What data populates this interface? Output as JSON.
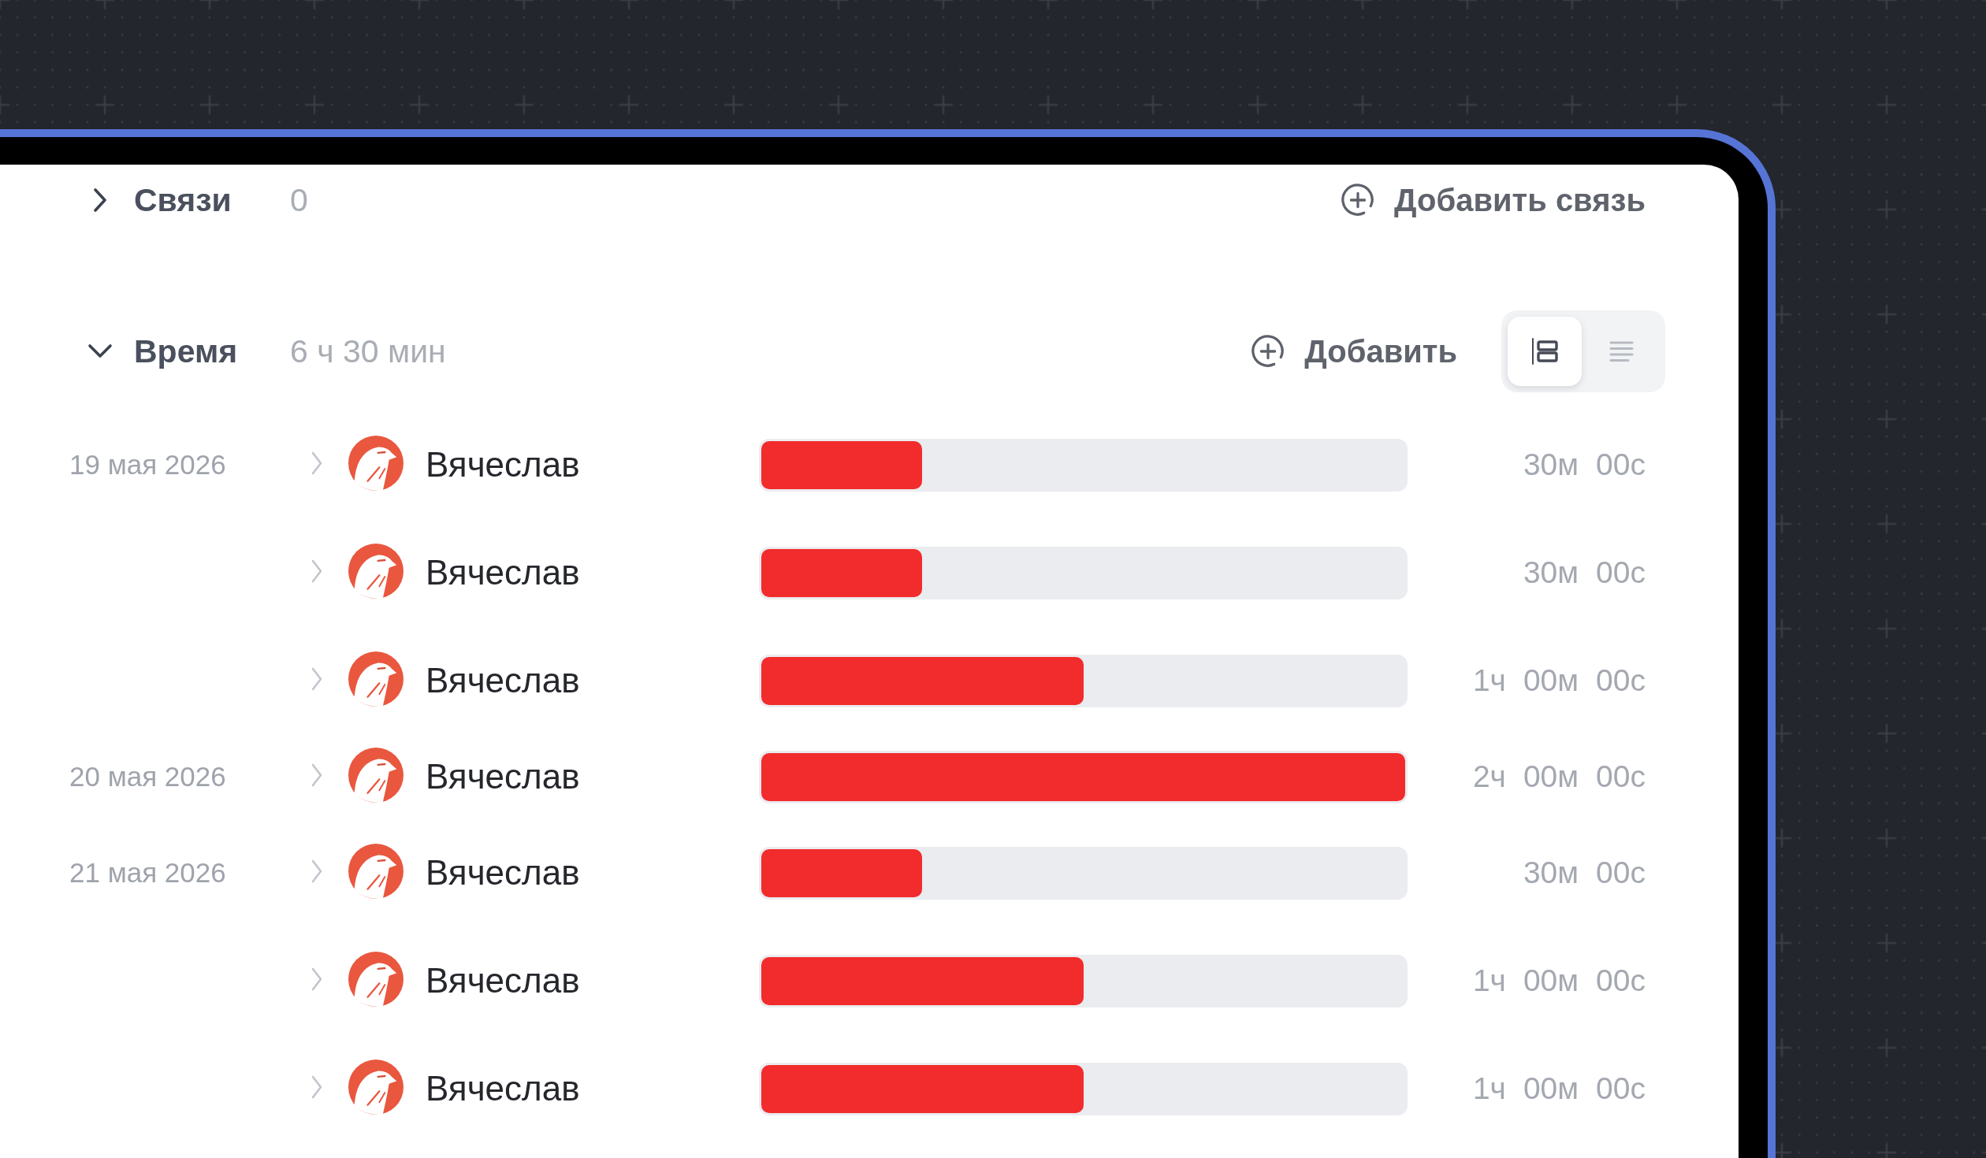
{
  "sections": [
    {
      "kind": "links",
      "title": "Связи",
      "count": "0",
      "expanded": false,
      "add_button": "Добавить связь"
    },
    {
      "kind": "time",
      "title": "Время",
      "count": "6 ч 30 мин",
      "expanded": true,
      "add_button": "Добавить",
      "view_toggle": [
        {
          "kind": "timeline",
          "selected": true
        },
        {
          "kind": "list",
          "selected": false
        }
      ],
      "groups": [
        {
          "date": "19 мая 2026",
          "entries": [
            {
              "name": "Вячеслав",
              "expanded": false,
              "level": 0.25,
              "duration": [
                "30м",
                "00с"
              ]
            },
            {
              "name": "Вячеслав",
              "expanded": false,
              "level": 0.25,
              "duration": [
                "30м",
                "00с"
              ]
            },
            {
              "name": "Вячеслав",
              "expanded": false,
              "level": 0.5,
              "duration": [
                "1ч",
                "00м",
                "00с"
              ]
            }
          ]
        },
        {
          "date": "20 мая 2026",
          "entries": [
            {
              "name": "Вячеслав",
              "expanded": false,
              "level": 1.0,
              "duration": [
                "2ч",
                "00м",
                "00с"
              ]
            }
          ]
        },
        {
          "date": "21 мая 2026",
          "entries": [
            {
              "name": "Вячеслав",
              "expanded": false,
              "level": 0.25,
              "duration": [
                "30м",
                "00с"
              ]
            },
            {
              "name": "Вячеслав",
              "expanded": false,
              "level": 0.5,
              "duration": [
                "1ч",
                "00м",
                "00с"
              ]
            },
            {
              "name": "Вячеслав",
              "expanded": false,
              "level": 0.5,
              "duration": [
                "1ч",
                "00м",
                "00с"
              ]
            }
          ]
        }
      ]
    }
  ]
}
